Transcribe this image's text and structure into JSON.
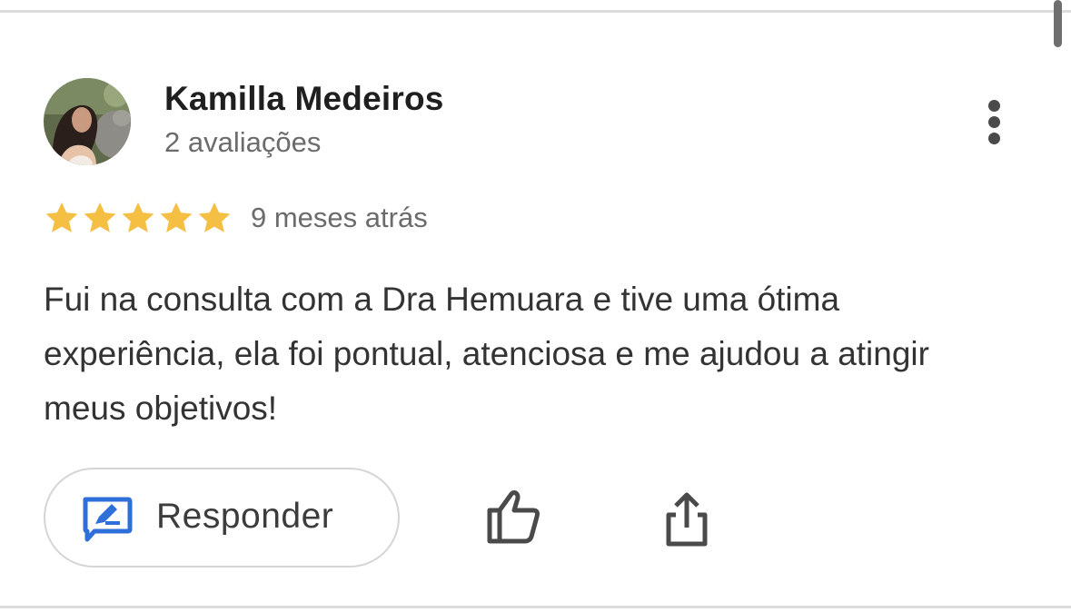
{
  "review": {
    "reviewer_name": "Kamilla Medeiros",
    "review_count": "2 avaliações",
    "rating": 5,
    "rating_max": 5,
    "time_ago": "9 meses atrás",
    "text": "Fui na consulta com a Dra Hemuara e tive uma ótima experiência, ela foi pontual, atenciosa e me ajudou a atingir meus objetivos!"
  },
  "actions": {
    "reply_label": "Responder"
  },
  "colors": {
    "star": "#f4bf42",
    "reply_icon": "#2f6fd9",
    "icon_gray": "#4a4a4a",
    "divider": "#dcdcdc"
  },
  "icons": [
    "avatar-photo",
    "more-vert-icon",
    "star-icon",
    "reply-icon",
    "thumb-up-icon",
    "share-icon"
  ]
}
